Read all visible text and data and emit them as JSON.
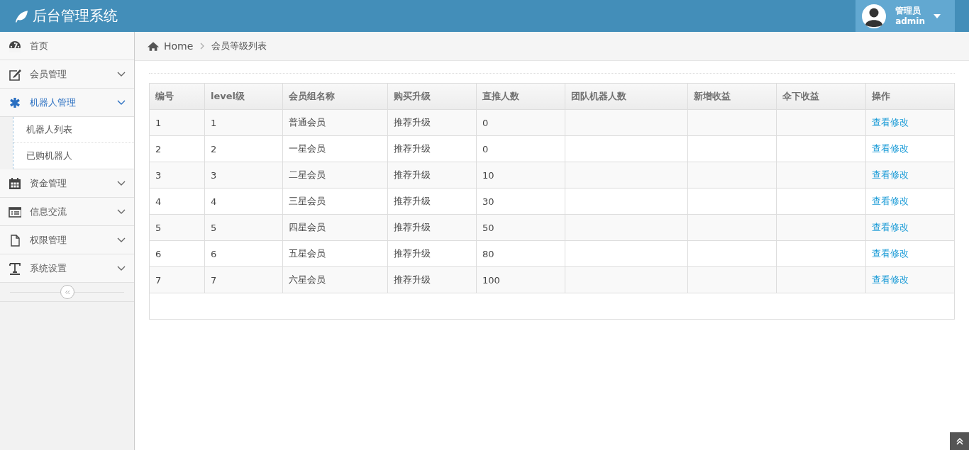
{
  "header": {
    "title": "后台管理系统",
    "user": {
      "role": "管理员",
      "name": "admin"
    }
  },
  "sidebar": {
    "items": [
      {
        "label": "首页",
        "selected": false,
        "kind": "link"
      },
      {
        "label": "会员管理",
        "selected": false,
        "kind": "group"
      },
      {
        "label": "机器人管理",
        "selected": true,
        "kind": "group",
        "children": [
          {
            "label": "机器人列表"
          },
          {
            "label": "已购机器人"
          }
        ]
      },
      {
        "label": "资金管理",
        "selected": false,
        "kind": "group"
      },
      {
        "label": "信息交流",
        "selected": false,
        "kind": "group"
      },
      {
        "label": "权限管理",
        "selected": false,
        "kind": "group"
      },
      {
        "label": "系统设置",
        "selected": false,
        "kind": "group"
      }
    ]
  },
  "breadcrumb": [
    "Home",
    "会员等级列表"
  ],
  "table": {
    "columns": [
      "编号",
      "level级",
      "会员组名称",
      "购买升级",
      "直推人数",
      "团队机器人数",
      "新增收益",
      "伞下收益",
      "操作"
    ],
    "rows": [
      {
        "cells": [
          "1",
          "1",
          "普通会员",
          "推荐升级",
          "0",
          "",
          "",
          ""
        ],
        "action": "查看修改"
      },
      {
        "cells": [
          "2",
          "2",
          "一星会员",
          "推荐升级",
          "0",
          "",
          "",
          ""
        ],
        "action": "查看修改"
      },
      {
        "cells": [
          "3",
          "3",
          "二星会员",
          "推荐升级",
          "10",
          "",
          "",
          ""
        ],
        "action": "查看修改"
      },
      {
        "cells": [
          "4",
          "4",
          "三星会员",
          "推荐升级",
          "30",
          "",
          "",
          ""
        ],
        "action": "查看修改"
      },
      {
        "cells": [
          "5",
          "5",
          "四星会员",
          "推荐升级",
          "50",
          "",
          "",
          ""
        ],
        "action": "查看修改"
      },
      {
        "cells": [
          "6",
          "6",
          "五星会员",
          "推荐升级",
          "80",
          "",
          "",
          ""
        ],
        "action": "查看修改"
      },
      {
        "cells": [
          "7",
          "7",
          "六星会员",
          "推荐升级",
          "100",
          "",
          "",
          ""
        ],
        "action": "查看修改"
      }
    ]
  }
}
